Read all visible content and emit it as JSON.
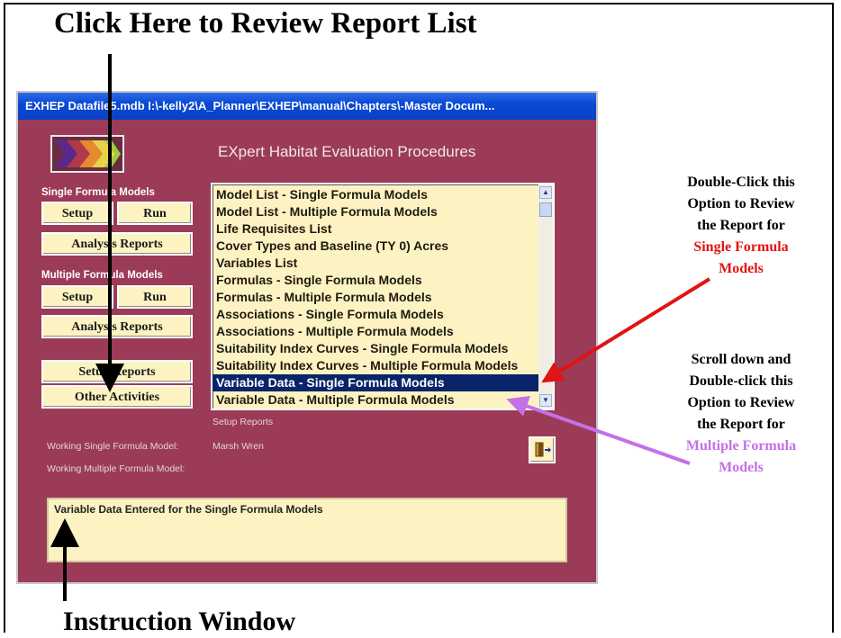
{
  "callouts": {
    "top": "Click Here to Review Report List",
    "bottom": "Instruction Window",
    "single_lines": [
      "Double-Click this",
      "Option to Review",
      "the Report for"
    ],
    "single_highlight_lines": [
      "Single Formula",
      "Models"
    ],
    "multiple_lines": [
      "Scroll down and",
      "Double-click this",
      "Option to Review",
      "the Report for"
    ],
    "multiple_highlight_lines": [
      "Multiple Formula",
      "Models"
    ]
  },
  "window": {
    "title": "EXHEP    Datafile5.mdb    I:\\-kelly2\\A_Planner\\EXHEP\\manual\\Chapters\\-Master Docum...",
    "app_title": "EXpert Habitat Evaluation Procedures"
  },
  "single": {
    "label": "Single Formula Models",
    "setup": "Setup",
    "run": "Run",
    "analysis": "Analysis Reports"
  },
  "multiple": {
    "label": "Multiple Formula Models",
    "setup": "Setup",
    "run": "Run",
    "analysis": "Analysis Reports"
  },
  "setup_reports_button": "Setup Reports",
  "other_activities_button": "Other Activities",
  "report_list": [
    "Model List - Single Formula Models",
    "Model List - Multiple Formula Models",
    "Life Requisites List",
    "Cover Types and Baseline (TY 0) Acres",
    "Variables List",
    "Formulas - Single Formula Models",
    "Formulas - Multiple Formula Models",
    "Associations - Single Formula Models",
    "Associations - Multiple Formula Models",
    "Suitability Index Curves - Single Formula Models",
    "Suitability Index Curves - Multiple Formula Models",
    "Variable Data - Single Formula Models",
    "Variable Data - Multiple Formula Models"
  ],
  "selected_index": 11,
  "list_caption": "Setup Reports",
  "working": {
    "single_label": "Working Single Formula Model:",
    "single_value": "Marsh Wren",
    "multiple_label": "Working Multiple Formula Model:",
    "multiple_value": ""
  },
  "instruction_text": "Variable Data Entered for the Single Formula Models",
  "icons": {
    "logo": "chevron-arrows-logo",
    "exit": "exit-door-icon",
    "scroll_up": "scroll-up-arrow-icon",
    "scroll_down": "scroll-down-arrow-icon"
  },
  "colors": {
    "form_background": "#9b3b58",
    "panel_cream": "#fdf3c2",
    "selection": "#0a246a",
    "red_callout": "#e11313",
    "violet_callout": "#c56fe8"
  }
}
